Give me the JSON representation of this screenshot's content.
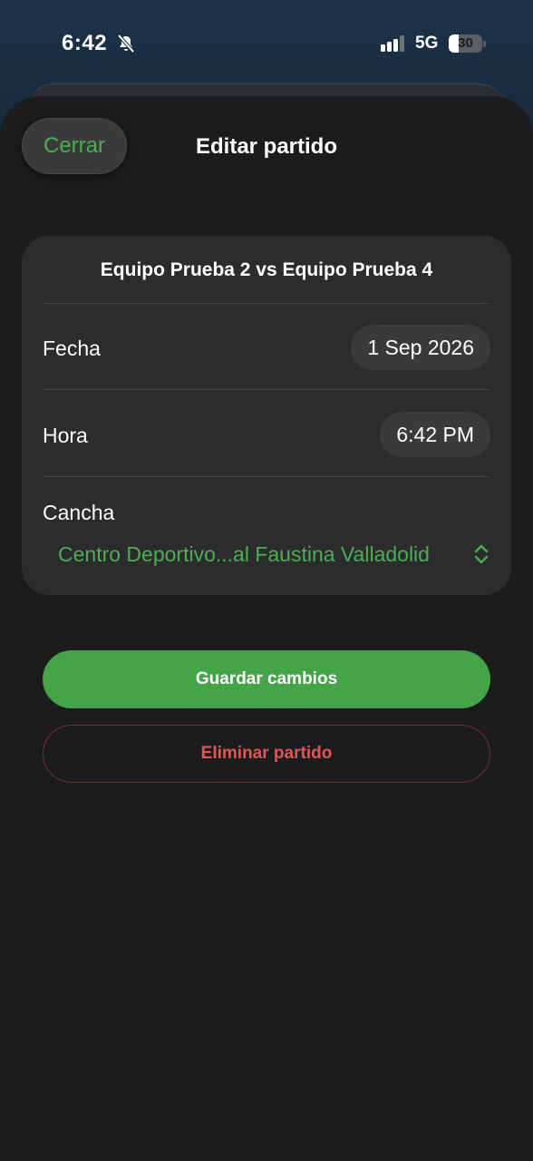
{
  "status_bar": {
    "time": "6:42",
    "network": "5G",
    "battery_percent": "30",
    "battery_level": 0.3,
    "icons": [
      "bell-slash-icon",
      "signal-icon",
      "battery-icon"
    ]
  },
  "header": {
    "close_label": "Cerrar",
    "title": "Editar partido"
  },
  "match": {
    "title": "Equipo Prueba 2 vs Equipo Prueba 4",
    "date_label": "Fecha",
    "date_value": "1 Sep 2026",
    "time_label": "Hora",
    "time_value": "6:42 PM",
    "court_label": "Cancha",
    "court_value": "Centro Deportivo...al Faustina Valladolid",
    "court_icon": "chevron-up-down-icon"
  },
  "actions": {
    "save_label": "Guardar cambios",
    "delete_label": "Eliminar partido"
  },
  "colors": {
    "accent_green": "#43a548",
    "link_green": "#4caf50",
    "danger_red": "#e05555",
    "sheet_bg": "#1c1c1e",
    "card_bg": "#2c2c2e"
  }
}
